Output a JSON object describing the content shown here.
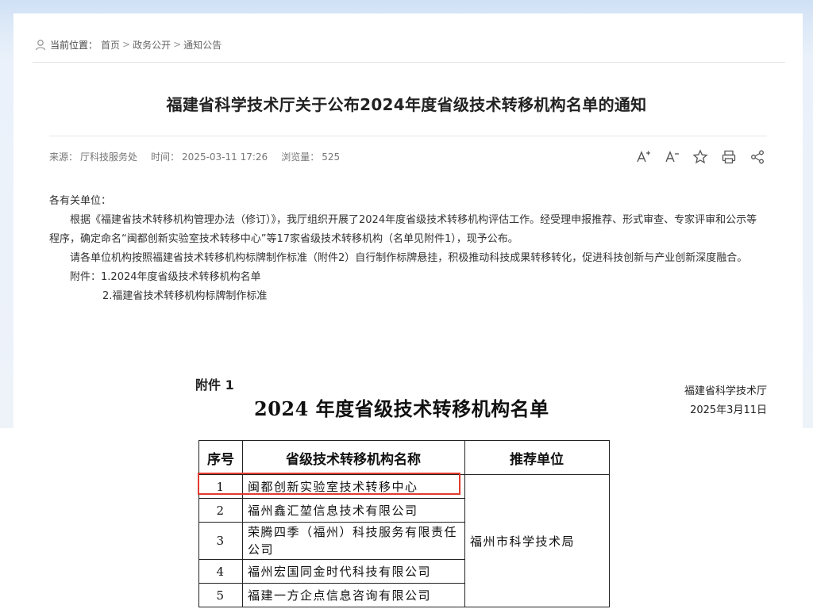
{
  "breadcrumb": {
    "label": "当前位置：",
    "items": [
      "首页",
      "政务公开",
      "通知公告"
    ],
    "separator": ">"
  },
  "article": {
    "title": "福建省科学技术厅关于公布2024年度省级技术转移机构名单的通知",
    "meta": {
      "source_label": "来源：",
      "source": "厅科技服务处",
      "time_label": "时间：",
      "time": "2025-03-11 17:26",
      "views_label": "浏览量：",
      "views": "525"
    },
    "tools": {
      "font_increase": "A+",
      "font_decrease": "A-"
    },
    "salutation": "各有关单位：",
    "paragraph1": "根据《福建省技术转移机构管理办法（修订）》，我厅组织开展了2024年度省级技术转移机构评估工作。经受理申报推荐、形式审查、专家评审和公示等程序，确定命名“闽都创新实验室技术转移中心”等17家省级技术转移机构（名单见附件1），现予公布。",
    "paragraph2": "请各单位机构按照福建省技术转移机构标牌制作标准（附件2）自行制作标牌悬挂，积极推动科技成果转移转化，促进科技创新与产业创新深度融合。",
    "attachment_label": "附件：",
    "attachment1": "1.2024年度省级技术转移机构名单",
    "attachment2": "2.福建省技术转移机构标牌制作标准"
  },
  "document": {
    "annex": "附件 1",
    "title": "2024 年度省级技术转移机构名单",
    "issuer": "福建省科学技术厅",
    "date": "2025年3月11日",
    "table": {
      "headers": [
        "序号",
        "省级技术转移机构名称",
        "推荐单位"
      ],
      "rows": [
        {
          "no": "1",
          "name": "闽都创新实验室技术转移中心"
        },
        {
          "no": "2",
          "name": "福州鑫汇堃信息技术有限公司"
        },
        {
          "no": "3",
          "name": "荣腾四季（福州）科技服务有限责任公司"
        },
        {
          "no": "4",
          "name": "福州宏国同金时代科技有限公司"
        },
        {
          "no": "5",
          "name": "福建一方企点信息咨询有限公司"
        }
      ],
      "recommender": "福州市科学技术局"
    }
  },
  "colors": {
    "highlight": "#e23b2e",
    "banner": "#dde9f7"
  }
}
